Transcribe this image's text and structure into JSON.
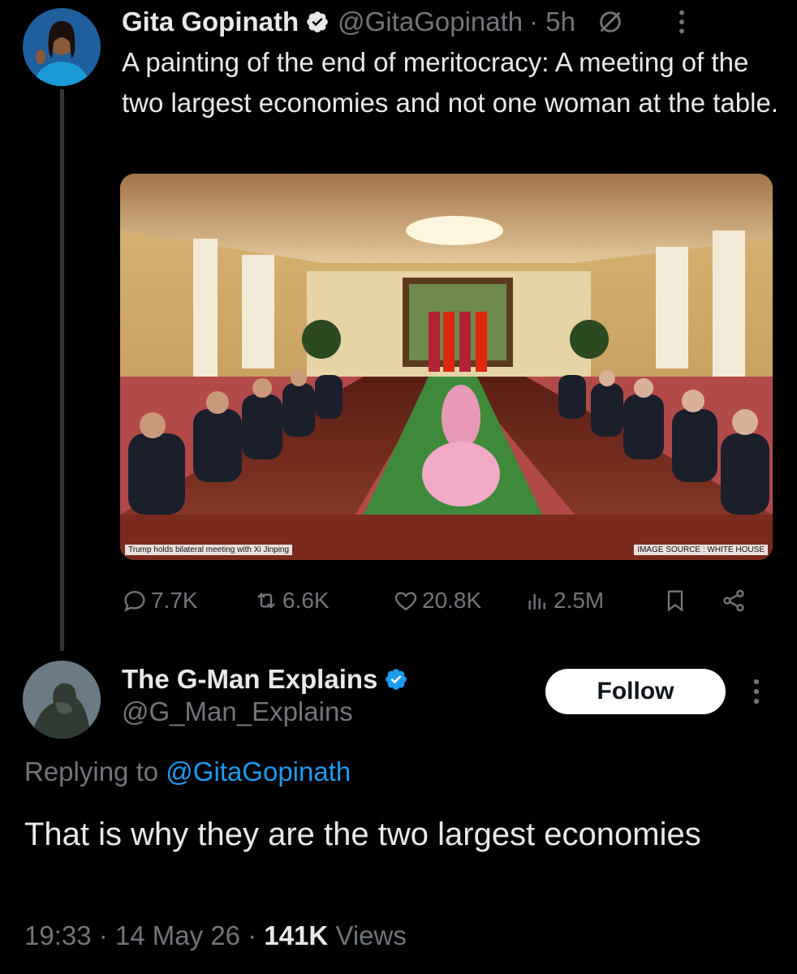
{
  "tweet": {
    "author_name": "Gita Gopinath",
    "author_handle": "@GitaGopinath",
    "time": "· 5h",
    "text": "A painting of the end of meritocracy: A meeting of the two largest economies and not one woman at the table.",
    "image": {
      "caption_left": "Trump holds bilateral meeting with Xi Jinping",
      "caption_right": "IMAGE SOURCE : WHITE HOUSE"
    },
    "stats": {
      "replies": "7.7K",
      "reposts": "6.6K",
      "likes": "20.8K",
      "views": "2.5M"
    }
  },
  "reply": {
    "author_name": "The G-Man Explains",
    "author_handle": "@G_Man_Explains",
    "follow_label": "Follow",
    "replying_prefix": "Replying to",
    "replying_to": "@GitaGopinath",
    "text": "That is why they are the two largest economies",
    "time": "19:33",
    "date": "14 May 26",
    "views_count": "141K",
    "views_label": "Views"
  },
  "colors": {
    "background": "#000000",
    "text": "#e7e9ea",
    "muted": "#71767b",
    "accent": "#1d9bf0",
    "verified": "#1d9bf0"
  },
  "icons": [
    "verified-badge-icon",
    "grok-slash-icon",
    "more-vertical-icon",
    "reply-icon",
    "repost-icon",
    "like-icon",
    "views-icon",
    "bookmark-icon",
    "share-icon"
  ]
}
